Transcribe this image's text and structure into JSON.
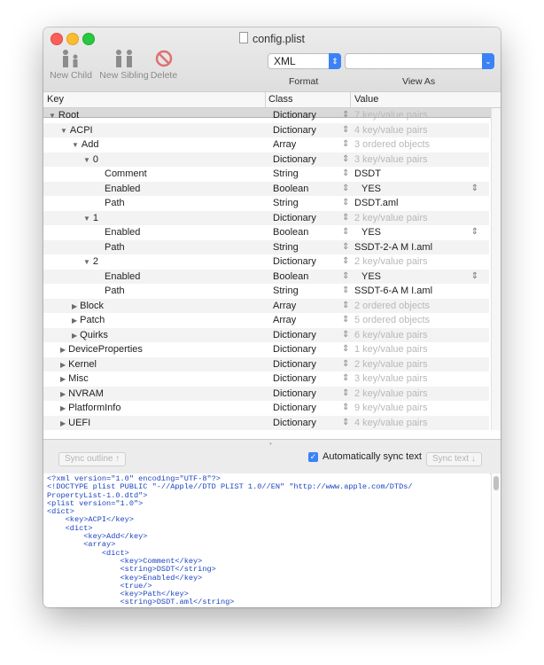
{
  "window": {
    "title": "config.plist"
  },
  "toolbar": {
    "new_child": "New Child",
    "new_sibling": "New Sibling",
    "delete": "Delete",
    "format_value": "XML",
    "format_label": "Format",
    "view_as_value": "",
    "view_as_label": "View As"
  },
  "columns": {
    "key": "Key",
    "class": "Class",
    "value": "Value"
  },
  "rows": [
    {
      "key": "Root",
      "depth": 0,
      "disclosure": "open",
      "class": "Dictionary",
      "value": "7 key/value pairs",
      "muted": true,
      "bool": false
    },
    {
      "key": "ACPI",
      "depth": 1,
      "disclosure": "open",
      "class": "Dictionary",
      "value": "4 key/value pairs",
      "muted": true,
      "bool": false
    },
    {
      "key": "Add",
      "depth": 2,
      "disclosure": "open",
      "class": "Array",
      "value": "3 ordered objects",
      "muted": true,
      "bool": false
    },
    {
      "key": "0",
      "depth": 3,
      "disclosure": "open",
      "class": "Dictionary",
      "value": "3 key/value pairs",
      "muted": true,
      "bool": false
    },
    {
      "key": "Comment",
      "depth": 4,
      "disclosure": "none",
      "class": "String",
      "value": "DSDT",
      "muted": false,
      "bool": false
    },
    {
      "key": "Enabled",
      "depth": 4,
      "disclosure": "none",
      "class": "Boolean",
      "value": "YES",
      "muted": false,
      "bool": true
    },
    {
      "key": "Path",
      "depth": 4,
      "disclosure": "none",
      "class": "String",
      "value": "DSDT.aml",
      "muted": false,
      "bool": false
    },
    {
      "key": "1",
      "depth": 3,
      "disclosure": "open",
      "class": "Dictionary",
      "value": "2 key/value pairs",
      "muted": true,
      "bool": false
    },
    {
      "key": "Enabled",
      "depth": 4,
      "disclosure": "none",
      "class": "Boolean",
      "value": "YES",
      "muted": false,
      "bool": true
    },
    {
      "key": "Path",
      "depth": 4,
      "disclosure": "none",
      "class": "String",
      "value": "SSDT-2-A M I.aml",
      "muted": false,
      "bool": false
    },
    {
      "key": "2",
      "depth": 3,
      "disclosure": "open",
      "class": "Dictionary",
      "value": "2 key/value pairs",
      "muted": true,
      "bool": false
    },
    {
      "key": "Enabled",
      "depth": 4,
      "disclosure": "none",
      "class": "Boolean",
      "value": "YES",
      "muted": false,
      "bool": true
    },
    {
      "key": "Path",
      "depth": 4,
      "disclosure": "none",
      "class": "String",
      "value": "SSDT-6-A M I.aml",
      "muted": false,
      "bool": false
    },
    {
      "key": "Block",
      "depth": 2,
      "disclosure": "closed",
      "class": "Array",
      "value": "2 ordered objects",
      "muted": true,
      "bool": false
    },
    {
      "key": "Patch",
      "depth": 2,
      "disclosure": "closed",
      "class": "Array",
      "value": "5 ordered objects",
      "muted": true,
      "bool": false
    },
    {
      "key": "Quirks",
      "depth": 2,
      "disclosure": "closed",
      "class": "Dictionary",
      "value": "6 key/value pairs",
      "muted": true,
      "bool": false
    },
    {
      "key": "DeviceProperties",
      "depth": 1,
      "disclosure": "closed",
      "class": "Dictionary",
      "value": "1 key/value pairs",
      "muted": true,
      "bool": false
    },
    {
      "key": "Kernel",
      "depth": 1,
      "disclosure": "closed",
      "class": "Dictionary",
      "value": "2 key/value pairs",
      "muted": true,
      "bool": false
    },
    {
      "key": "Misc",
      "depth": 1,
      "disclosure": "closed",
      "class": "Dictionary",
      "value": "3 key/value pairs",
      "muted": true,
      "bool": false
    },
    {
      "key": "NVRAM",
      "depth": 1,
      "disclosure": "closed",
      "class": "Dictionary",
      "value": "2 key/value pairs",
      "muted": true,
      "bool": false
    },
    {
      "key": "PlatformInfo",
      "depth": 1,
      "disclosure": "closed",
      "class": "Dictionary",
      "value": "9 key/value pairs",
      "muted": true,
      "bool": false
    },
    {
      "key": "UEFI",
      "depth": 1,
      "disclosure": "closed",
      "class": "Dictionary",
      "value": "4 key/value pairs",
      "muted": true,
      "bool": false
    }
  ],
  "sync": {
    "sync_outline": "Sync outline ↑",
    "auto_sync": "Automatically sync text",
    "auto_sync_checked": true,
    "sync_text": "Sync text ↓"
  },
  "xml_lines": [
    "<?xml version=\"1.0\" encoding=\"UTF-8\"?>",
    "<!DOCTYPE plist PUBLIC \"-//Apple//DTD PLIST 1.0//EN\" \"http://www.apple.com/DTDs/",
    "PropertyList-1.0.dtd\">",
    "<plist version=\"1.0\">",
    "<dict>",
    "    <key>ACPI</key>",
    "    <dict>",
    "        <key>Add</key>",
    "        <array>",
    "            <dict>",
    "                <key>Comment</key>",
    "                <string>DSDT</string>",
    "                <key>Enabled</key>",
    "                <true/>",
    "                <key>Path</key>",
    "                <string>DSDT.aml</string>"
  ]
}
